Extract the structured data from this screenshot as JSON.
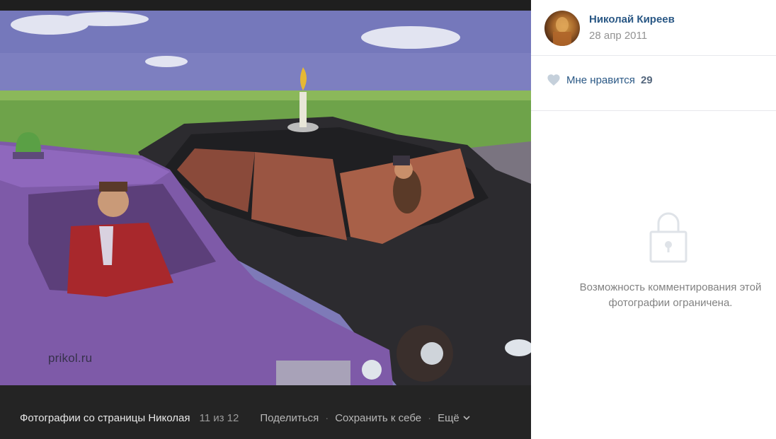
{
  "viewer": {
    "watermark": "prikol.ru",
    "album_title": "Фотографии со страницы Николая",
    "counter": "11 из 12",
    "share_label": "Поделиться",
    "save_label": "Сохранить к себе",
    "more_label": "Ещё",
    "separator": "·"
  },
  "panel": {
    "author_name": "Николай Киреев",
    "date": "28 апр 2011",
    "like_label": "Мне нравится",
    "like_count": "29",
    "comments_restricted_text": "Возможность комментирования этой фотографии ограничена."
  },
  "icons": {
    "like": "heart-icon",
    "lock": "lock-icon",
    "more": "chevron-down-icon"
  },
  "colors": {
    "link": "#2a5885",
    "viewer_bg": "#222222",
    "muted": "#939393"
  }
}
